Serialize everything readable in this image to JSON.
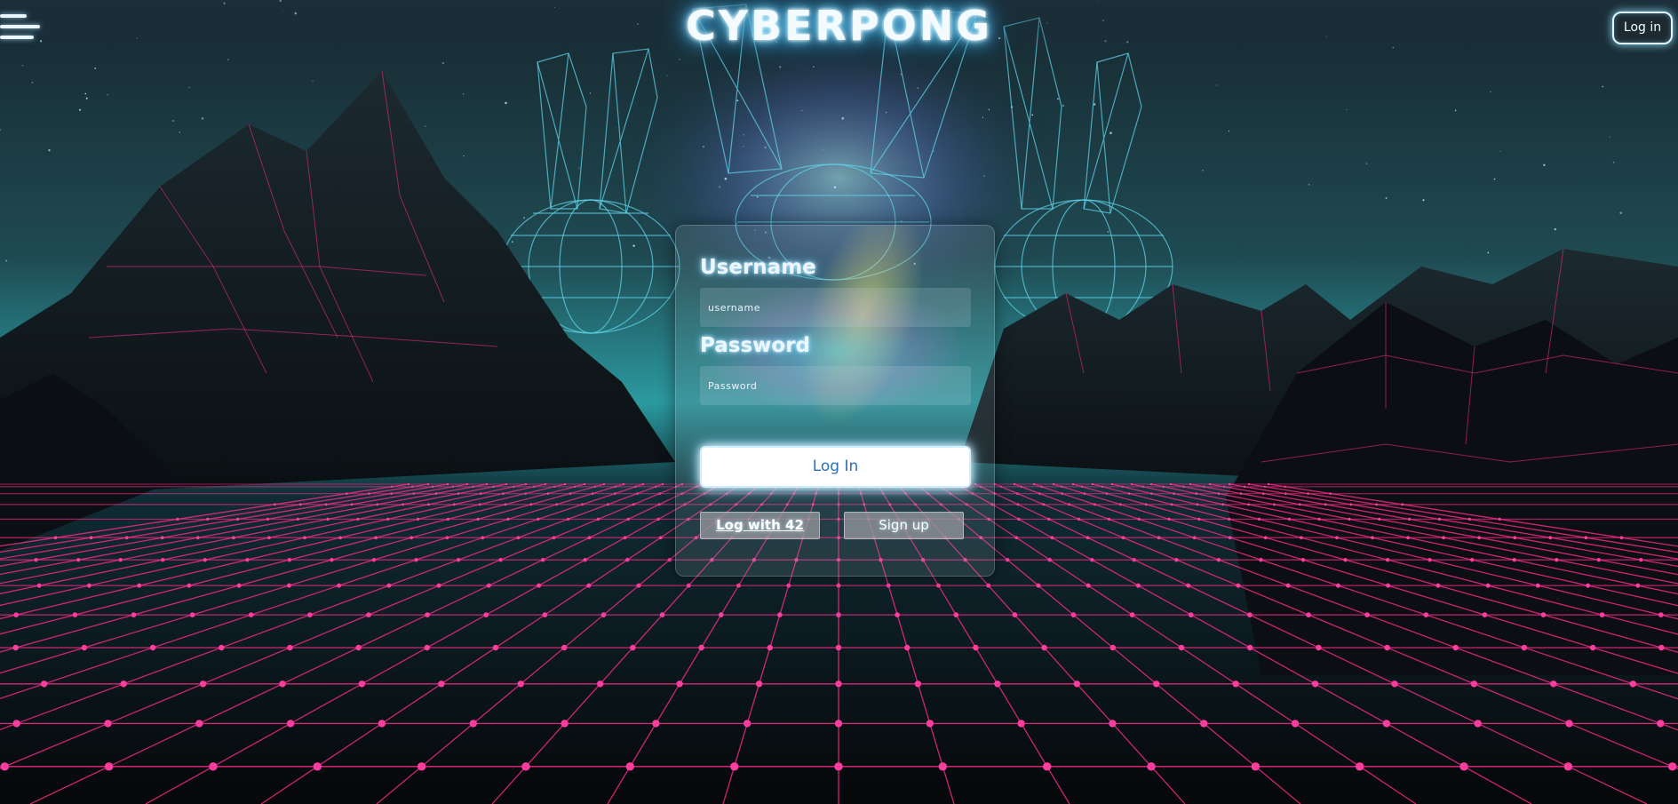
{
  "header": {
    "brand": "CYBERPONG",
    "login_button": "Log in",
    "menu_icon": "hamburger-menu-icon"
  },
  "login_form": {
    "username_label": "Username",
    "username_placeholder": "username",
    "password_label": "Password",
    "password_placeholder": "Password",
    "submit_label": "Log In",
    "login_42_label": "Log with 42",
    "signup_label": "Sign up"
  },
  "colors": {
    "grid_lines": "#ff2a8a",
    "grid_nodes": "#ff3d9e",
    "wireframe": "#5fd0e6",
    "sky_top": "#16262f",
    "sky_horizon": "#2a8f98",
    "accent_button_text": "#2d6fb3"
  }
}
